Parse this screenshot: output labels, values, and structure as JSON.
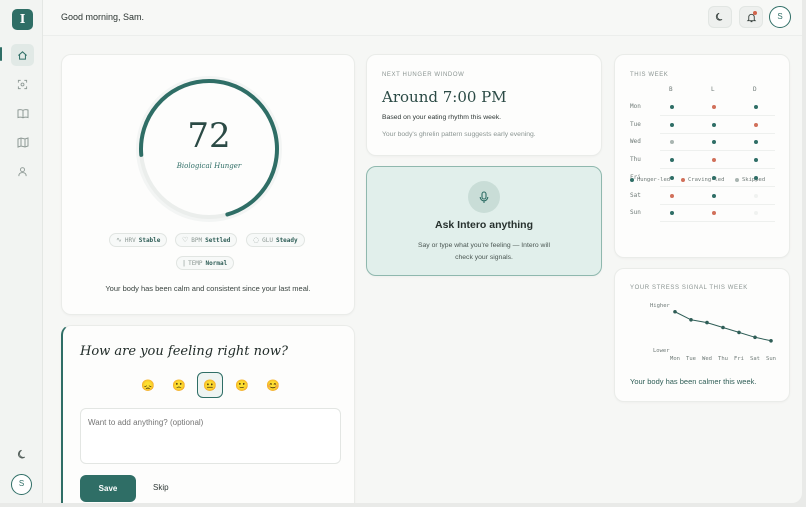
{
  "app": {
    "logo_letter": "I"
  },
  "header": {
    "greeting": "Good morning, Sam.",
    "avatar_initial": "S"
  },
  "sidebar": {
    "items": [
      {
        "name": "home",
        "icon": "home-icon",
        "active": true
      },
      {
        "name": "scan",
        "icon": "scan-icon",
        "active": false
      },
      {
        "name": "journal",
        "icon": "book-icon",
        "active": false
      },
      {
        "name": "map",
        "icon": "map-icon",
        "active": false
      },
      {
        "name": "profile",
        "icon": "user-icon",
        "active": false
      }
    ],
    "avatar_initial": "S"
  },
  "hunger": {
    "value": "72",
    "level_fraction": 0.72,
    "label": "Biological Hunger",
    "metrics": [
      {
        "key": "HRV",
        "value": "Stable",
        "icon": "wave-icon"
      },
      {
        "key": "BPM",
        "value": "Settled",
        "icon": "heart-icon"
      },
      {
        "key": "GLU",
        "value": "Steady",
        "icon": "drop-icon"
      },
      {
        "key": "TEMP",
        "value": "Normal",
        "icon": "thermometer-icon"
      }
    ],
    "footer": "Your body has been calm and consistent since your last meal."
  },
  "feeling": {
    "title": "How are you feeling right now?",
    "options": [
      {
        "glyph": "😞",
        "selected": false
      },
      {
        "glyph": "🙁",
        "selected": false
      },
      {
        "glyph": "😐",
        "selected": true
      },
      {
        "glyph": "🙂",
        "selected": false
      },
      {
        "glyph": "😊",
        "selected": false
      }
    ],
    "placeholder": "Want to add anything? (optional)",
    "save_label": "Save",
    "skip_label": "Skip"
  },
  "next_hunger": {
    "eyebrow": "NEXT HUNGER WINDOW",
    "time": "Around 7:00 PM",
    "line1": "Based on your eating rhythm this week.",
    "line2": "Your body's ghrelin pattern suggests early evening."
  },
  "ask": {
    "title": "Ask Intero anything",
    "subtitle": "Say or type what you're feeling — Intero will check your signals."
  },
  "week": {
    "title": "THIS WEEK",
    "columns": [
      "B",
      "L",
      "D"
    ],
    "days": [
      "Mon",
      "Tue",
      "Wed",
      "Thu",
      "Fri",
      "Sat",
      "Sun"
    ],
    "grid": [
      [
        "hunger",
        "craving",
        "hunger"
      ],
      [
        "hunger",
        "hunger",
        "craving"
      ],
      [
        "skipped",
        "hunger",
        "hunger"
      ],
      [
        "hunger",
        "craving",
        "hunger"
      ],
      [
        "hunger",
        "hunger",
        "hunger"
      ],
      [
        "craving",
        "hunger",
        "none"
      ],
      [
        "hunger",
        "craving",
        "none"
      ]
    ],
    "legend": [
      {
        "key": "hunger",
        "label": "Hunger-led",
        "color": "#2f6e66"
      },
      {
        "key": "craving",
        "label": "Craving-led",
        "color": "#d1705a"
      },
      {
        "key": "skipped",
        "label": "Skipped",
        "color": "#a9b5b1"
      }
    ]
  },
  "stress": {
    "title": "YOUR STRESS SIGNAL THIS WEEK",
    "high_label": "Higher",
    "low_label": "Lower",
    "days": [
      "Mon",
      "Tue",
      "Wed",
      "Thu",
      "Fri",
      "Sat",
      "Sun"
    ],
    "values": [
      0.95,
      0.72,
      0.64,
      0.5,
      0.36,
      0.22,
      0.12
    ],
    "footer": "Your body has been calmer this week."
  },
  "colors": {
    "accent": "#2f6e66",
    "craving": "#d1705a",
    "skipped": "#a9b5b1"
  }
}
